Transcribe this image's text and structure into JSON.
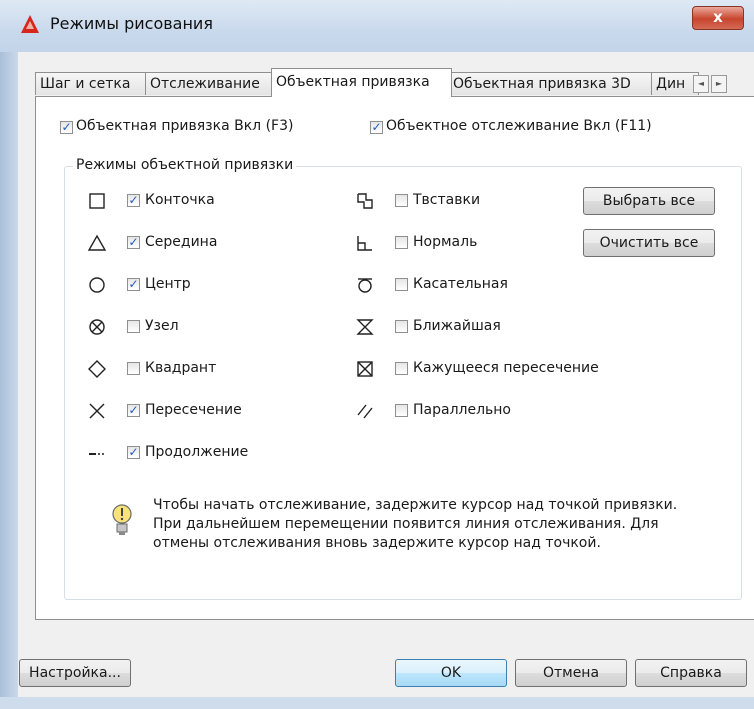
{
  "window": {
    "title": "Режимы рисования",
    "close_glyph": "x",
    "icon": "autocad-logo-icon",
    "accent_color": "#c8442e"
  },
  "tabs": [
    {
      "label": "Шаг и сетка",
      "active": false
    },
    {
      "label": "Отслеживание",
      "active": false
    },
    {
      "label": "Объектная привязка",
      "active": true
    },
    {
      "label": "Объектная привязка 3D",
      "active": false
    },
    {
      "label": "Дин",
      "active": false
    }
  ],
  "tab_scroll": {
    "left": "◄",
    "right": "►"
  },
  "top_options": {
    "osnap_on": {
      "label": "Объектная привязка Вкл (F3)",
      "checked": true
    },
    "otrack_on": {
      "label": "Объектное отслеживание Вкл (F11)",
      "checked": true
    }
  },
  "group": {
    "title": "Режимы объектной привязки",
    "left_modes": [
      {
        "label": "Конточка",
        "checked": true,
        "icon": "endpoint-square-icon"
      },
      {
        "label": "Середина",
        "checked": true,
        "icon": "midpoint-triangle-icon"
      },
      {
        "label": "Центр",
        "checked": true,
        "icon": "center-circle-icon"
      },
      {
        "label": "Узел",
        "checked": false,
        "icon": "node-icon"
      },
      {
        "label": "Квадрант",
        "checked": false,
        "icon": "quadrant-diamond-icon"
      },
      {
        "label": "Пересечение",
        "checked": true,
        "icon": "intersection-x-icon"
      },
      {
        "label": "Продолжение",
        "checked": true,
        "icon": "extension-icon"
      }
    ],
    "right_modes": [
      {
        "label": "Твставки",
        "checked": false,
        "icon": "insertion-icon"
      },
      {
        "label": "Нормаль",
        "checked": false,
        "icon": "perpendicular-icon"
      },
      {
        "label": "Касательная",
        "checked": false,
        "icon": "tangent-icon"
      },
      {
        "label": "Ближайшая",
        "checked": false,
        "icon": "nearest-hourglass-icon"
      },
      {
        "label": "Кажущееся пересечение",
        "checked": false,
        "icon": "apparent-intersection-icon"
      },
      {
        "label": "Параллельно",
        "checked": false,
        "icon": "parallel-icon"
      }
    ],
    "select_all_label": "Выбрать все",
    "clear_all_label": "Очистить все",
    "tip_lines": [
      "Чтобы начать отслеживание, задержите курсор над точкой привязки.",
      "При дальнейшем перемещении появится линия отслеживания. Для",
      "отмены отслеживания вновь задержите курсор над точкой."
    ],
    "tip_icon": "lightbulb-icon"
  },
  "footer": {
    "settings_label": "Настройка...",
    "ok_label": "OK",
    "cancel_label": "Отмена",
    "help_label": "Справка"
  }
}
